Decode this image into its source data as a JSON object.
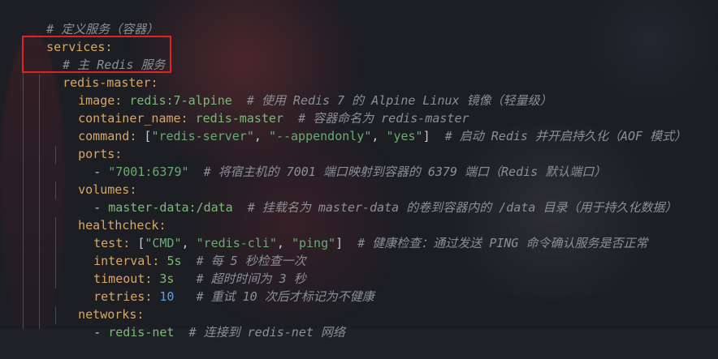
{
  "lines": {
    "l1_comment": "# 定义服务（容器）",
    "l2_key": "services:",
    "l3_comment": "# 主 Redis 服务",
    "l4_key": "redis-master:",
    "l5_key": "image:",
    "l5_val": "redis:7-alpine",
    "l5_comment": "# 使用 Redis 7 的 Alpine Linux 镜像（轻量级）",
    "l6_key": "container_name:",
    "l6_val": "redis-master",
    "l6_comment": "# 容器命名为 redis-master",
    "l7_key": "command:",
    "l7_open": "[",
    "l7_s1": "\"redis-server\"",
    "l7_comma1": ", ",
    "l7_s2": "\"--appendonly\"",
    "l7_comma2": ", ",
    "l7_s3": "\"yes\"",
    "l7_close": "]",
    "l7_comment": "# 启动 Redis 并开启持久化（AOF 模式）",
    "l8_key": "ports:",
    "l9_dash": "- ",
    "l9_val": "\"7001:6379\"",
    "l9_comment": "# 将宿主机的 7001 端口映射到容器的 6379 端口（Redis 默认端口）",
    "l10_key": "volumes:",
    "l11_dash": "- ",
    "l11_val": "master-data:/data",
    "l11_comment": "# 挂载名为 master-data 的卷到容器内的 /data 目录（用于持久化数据）",
    "l12_key": "healthcheck:",
    "l13_key": "test:",
    "l13_open": "[",
    "l13_s1": "\"CMD\"",
    "l13_comma1": ", ",
    "l13_s2": "\"redis-cli\"",
    "l13_comma2": ", ",
    "l13_s3": "\"ping\"",
    "l13_close": "]",
    "l13_comment": "# 健康检查：通过发送 PING 命令确认服务是否正常",
    "l14_key": "interval:",
    "l14_val": "5s",
    "l14_comment": "# 每 5 秒检查一次",
    "l15_key": "timeout:",
    "l15_val": "3s",
    "l15_comment": "# 超时时间为 3 秒",
    "l16_key": "retries:",
    "l16_val": "10",
    "l16_comment": "# 重试 10 次后才标记为不健康",
    "l17_key": "networks:",
    "l18_dash": "- ",
    "l18_val": "redis-net",
    "l18_comment": "# 连接到 redis-net 网络"
  },
  "colors": {
    "comment": "#8a8f98",
    "key": "#d7a866",
    "string": "#6aab73",
    "number": "#5aa1ea",
    "highlight": "#e02424"
  }
}
